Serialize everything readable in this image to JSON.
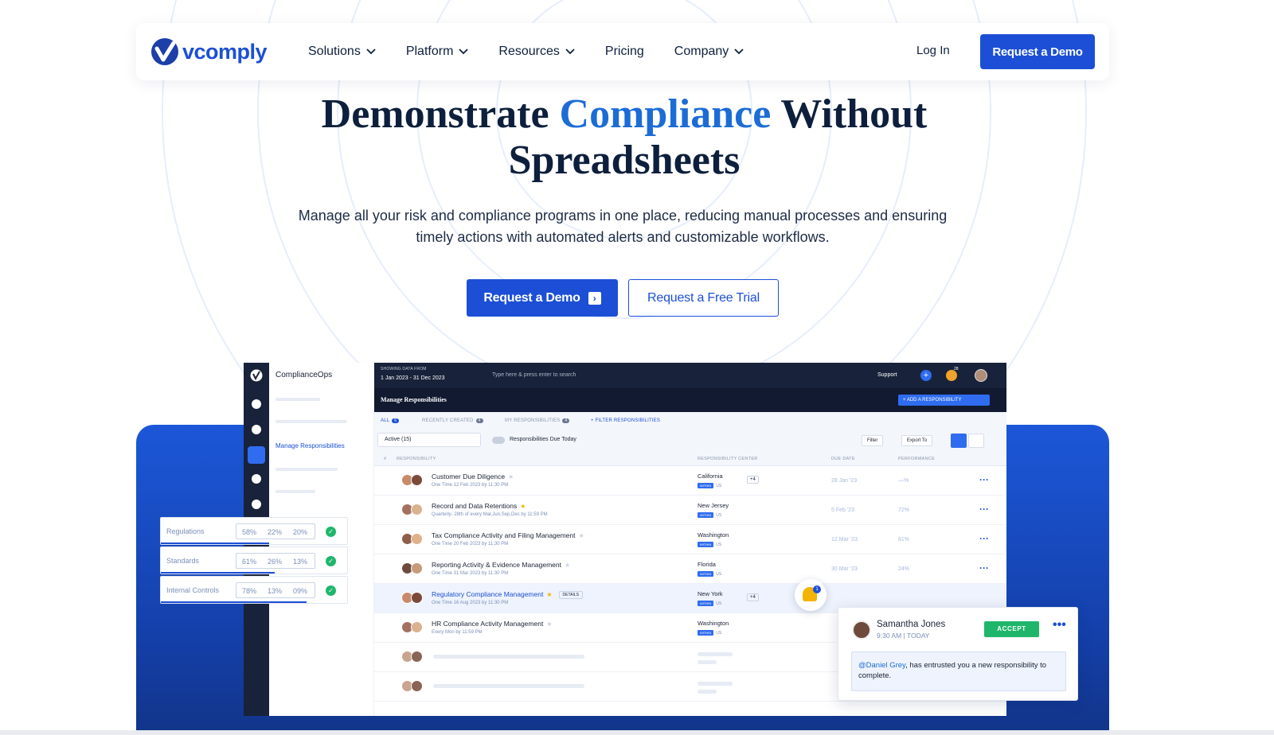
{
  "nav": {
    "logo_text": "vcomply",
    "menu": [
      {
        "label": "Solutions",
        "has_dropdown": true
      },
      {
        "label": "Platform",
        "has_dropdown": true
      },
      {
        "label": "Resources",
        "has_dropdown": true
      },
      {
        "label": "Pricing",
        "has_dropdown": false
      },
      {
        "label": "Company",
        "has_dropdown": true
      }
    ],
    "login_label": "Log In",
    "cta_label": "Request a Demo"
  },
  "hero": {
    "title_part1": "Demonstrate",
    "title_accent": "Compliance",
    "title_part2": "Without",
    "title_line2": "Spreadsheets",
    "subtitle": "Manage all your risk and compliance programs in one place, reducing manual processes and ensuring timely actions with automated alerts and customizable workflows.",
    "primary_button": "Request a Demo",
    "secondary_button": "Request a Free Trial"
  },
  "colors": {
    "brand_blue": "#1c4fd6",
    "accent_blue": "#1c6cd6",
    "dark_navy": "#18223a",
    "success_green": "#1fb66b",
    "star_gold": "#f2b400"
  },
  "app": {
    "workspace_name": "ComplianceOps",
    "sidebar_active_item": "Manage Responsibilities",
    "date_caption": "SHOWING DATA FROM",
    "date_range": "1 Jan 2023  -  31 Dec 2023",
    "search_placeholder": "Type here & press enter to search",
    "support_label": "Support",
    "notification_count": "28",
    "page_title": "Manage Responsibilities",
    "add_button": "+  ADD A RESPONSIBILITY",
    "tabs": [
      {
        "label": "ALL",
        "count": "6",
        "active": true
      },
      {
        "label": "RECENTLY CREATED",
        "count": "4",
        "active": false
      },
      {
        "label": "MY RESPONSIBILITIES",
        "count": "4",
        "active": false
      },
      {
        "label": "+  FILTER RESPONSIBILITIES",
        "count": "",
        "active": false
      }
    ],
    "status_filter": "Active (15)",
    "due_today_label": "Responsibilities Due Today",
    "filter_label": "Filter",
    "export_label": "Export To",
    "columns": [
      "#",
      "RESPONSIBILITY",
      "RESPONSIBILITY CENTER",
      "DUE DATE",
      "PERFORMANCE"
    ],
    "rows": [
      {
        "name": "Customer Due Diligence",
        "starred": false,
        "schedule": "One Time 12 Feb 2023 by 11:30 PM",
        "center": "California",
        "within": "US",
        "extra": "+4",
        "due": "28 Jan '23",
        "perf": "—%",
        "highlight": false,
        "details": ""
      },
      {
        "name": "Record and Data Retentions",
        "starred": true,
        "schedule": "Quarterly- 28th of every Mar,Jun,Sep,Dec by 11:59 PM",
        "center": "New Jersey",
        "within": "US",
        "extra": "",
        "due": "5 Feb '23",
        "perf": "72%",
        "highlight": false,
        "details": ""
      },
      {
        "name": "Tax Compliance Activity and Filing Management",
        "starred": false,
        "schedule": "One Time 20 Feb 2023 by 11:30 PM",
        "center": "Washington",
        "within": "US",
        "extra": "",
        "due": "12 Mar '23",
        "perf": "81%",
        "highlight": false,
        "details": ""
      },
      {
        "name": "Reporting Activity & Evidence Management",
        "starred": false,
        "schedule": "One Time 31 Mar 2023 by 11:30 PM",
        "center": "Florida",
        "within": "US",
        "extra": "",
        "due": "30 Mar '23",
        "perf": "24%",
        "highlight": false,
        "details": ""
      },
      {
        "name": "Regulatory Compliance Management",
        "starred": true,
        "schedule": "One Time 16 Aug 2023 by 11:30 PM",
        "center": "New York",
        "within": "US",
        "extra": "+4",
        "due": "",
        "perf": "",
        "highlight": true,
        "details": "DETAILS"
      },
      {
        "name": "HR Compliance Activity Management",
        "starred": false,
        "schedule": "Every Mon by 11:59 PM",
        "center": "Washington",
        "within": "US",
        "extra": "",
        "due": "",
        "perf": "",
        "highlight": false,
        "details": ""
      }
    ],
    "within_tag": "WITHIN"
  },
  "metrics": [
    {
      "label": "Regulations",
      "v1": "58%",
      "v2": "22%",
      "v3": "20%",
      "fill": 0.58
    },
    {
      "label": "Standards",
      "v1": "61%",
      "v2": "26%",
      "v3": "13%",
      "fill": 0.61
    },
    {
      "label": "Internal Controls",
      "v1": "78%",
      "v2": "13%",
      "v3": "09%",
      "fill": 0.78
    }
  ],
  "notification": {
    "bell_count": "1",
    "name": "Samantha Jones",
    "time": "9:30 AM  |  TODAY",
    "accept_label": "ACCEPT",
    "mention": "@Daniel Grey",
    "message": ", has entrusted you a new responsibility to complete."
  }
}
